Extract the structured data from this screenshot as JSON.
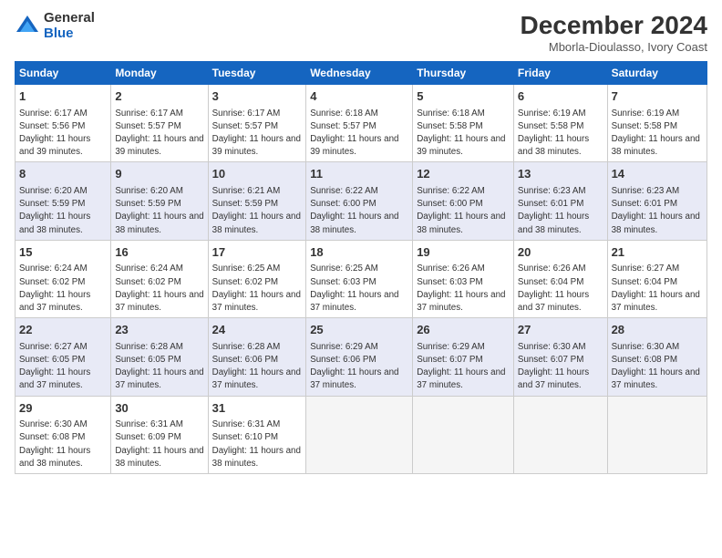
{
  "logo": {
    "general": "General",
    "blue": "Blue"
  },
  "title": "December 2024",
  "subtitle": "Mborla-Dioulasso, Ivory Coast",
  "header_days": [
    "Sunday",
    "Monday",
    "Tuesday",
    "Wednesday",
    "Thursday",
    "Friday",
    "Saturday"
  ],
  "weeks": [
    [
      {
        "day": "1",
        "sunrise": "Sunrise: 6:17 AM",
        "sunset": "Sunset: 5:56 PM",
        "daylight": "Daylight: 11 hours and 39 minutes."
      },
      {
        "day": "2",
        "sunrise": "Sunrise: 6:17 AM",
        "sunset": "Sunset: 5:57 PM",
        "daylight": "Daylight: 11 hours and 39 minutes."
      },
      {
        "day": "3",
        "sunrise": "Sunrise: 6:17 AM",
        "sunset": "Sunset: 5:57 PM",
        "daylight": "Daylight: 11 hours and 39 minutes."
      },
      {
        "day": "4",
        "sunrise": "Sunrise: 6:18 AM",
        "sunset": "Sunset: 5:57 PM",
        "daylight": "Daylight: 11 hours and 39 minutes."
      },
      {
        "day": "5",
        "sunrise": "Sunrise: 6:18 AM",
        "sunset": "Sunset: 5:58 PM",
        "daylight": "Daylight: 11 hours and 39 minutes."
      },
      {
        "day": "6",
        "sunrise": "Sunrise: 6:19 AM",
        "sunset": "Sunset: 5:58 PM",
        "daylight": "Daylight: 11 hours and 38 minutes."
      },
      {
        "day": "7",
        "sunrise": "Sunrise: 6:19 AM",
        "sunset": "Sunset: 5:58 PM",
        "daylight": "Daylight: 11 hours and 38 minutes."
      }
    ],
    [
      {
        "day": "8",
        "sunrise": "Sunrise: 6:20 AM",
        "sunset": "Sunset: 5:59 PM",
        "daylight": "Daylight: 11 hours and 38 minutes."
      },
      {
        "day": "9",
        "sunrise": "Sunrise: 6:20 AM",
        "sunset": "Sunset: 5:59 PM",
        "daylight": "Daylight: 11 hours and 38 minutes."
      },
      {
        "day": "10",
        "sunrise": "Sunrise: 6:21 AM",
        "sunset": "Sunset: 5:59 PM",
        "daylight": "Daylight: 11 hours and 38 minutes."
      },
      {
        "day": "11",
        "sunrise": "Sunrise: 6:22 AM",
        "sunset": "Sunset: 6:00 PM",
        "daylight": "Daylight: 11 hours and 38 minutes."
      },
      {
        "day": "12",
        "sunrise": "Sunrise: 6:22 AM",
        "sunset": "Sunset: 6:00 PM",
        "daylight": "Daylight: 11 hours and 38 minutes."
      },
      {
        "day": "13",
        "sunrise": "Sunrise: 6:23 AM",
        "sunset": "Sunset: 6:01 PM",
        "daylight": "Daylight: 11 hours and 38 minutes."
      },
      {
        "day": "14",
        "sunrise": "Sunrise: 6:23 AM",
        "sunset": "Sunset: 6:01 PM",
        "daylight": "Daylight: 11 hours and 38 minutes."
      }
    ],
    [
      {
        "day": "15",
        "sunrise": "Sunrise: 6:24 AM",
        "sunset": "Sunset: 6:02 PM",
        "daylight": "Daylight: 11 hours and 37 minutes."
      },
      {
        "day": "16",
        "sunrise": "Sunrise: 6:24 AM",
        "sunset": "Sunset: 6:02 PM",
        "daylight": "Daylight: 11 hours and 37 minutes."
      },
      {
        "day": "17",
        "sunrise": "Sunrise: 6:25 AM",
        "sunset": "Sunset: 6:02 PM",
        "daylight": "Daylight: 11 hours and 37 minutes."
      },
      {
        "day": "18",
        "sunrise": "Sunrise: 6:25 AM",
        "sunset": "Sunset: 6:03 PM",
        "daylight": "Daylight: 11 hours and 37 minutes."
      },
      {
        "day": "19",
        "sunrise": "Sunrise: 6:26 AM",
        "sunset": "Sunset: 6:03 PM",
        "daylight": "Daylight: 11 hours and 37 minutes."
      },
      {
        "day": "20",
        "sunrise": "Sunrise: 6:26 AM",
        "sunset": "Sunset: 6:04 PM",
        "daylight": "Daylight: 11 hours and 37 minutes."
      },
      {
        "day": "21",
        "sunrise": "Sunrise: 6:27 AM",
        "sunset": "Sunset: 6:04 PM",
        "daylight": "Daylight: 11 hours and 37 minutes."
      }
    ],
    [
      {
        "day": "22",
        "sunrise": "Sunrise: 6:27 AM",
        "sunset": "Sunset: 6:05 PM",
        "daylight": "Daylight: 11 hours and 37 minutes."
      },
      {
        "day": "23",
        "sunrise": "Sunrise: 6:28 AM",
        "sunset": "Sunset: 6:05 PM",
        "daylight": "Daylight: 11 hours and 37 minutes."
      },
      {
        "day": "24",
        "sunrise": "Sunrise: 6:28 AM",
        "sunset": "Sunset: 6:06 PM",
        "daylight": "Daylight: 11 hours and 37 minutes."
      },
      {
        "day": "25",
        "sunrise": "Sunrise: 6:29 AM",
        "sunset": "Sunset: 6:06 PM",
        "daylight": "Daylight: 11 hours and 37 minutes."
      },
      {
        "day": "26",
        "sunrise": "Sunrise: 6:29 AM",
        "sunset": "Sunset: 6:07 PM",
        "daylight": "Daylight: 11 hours and 37 minutes."
      },
      {
        "day": "27",
        "sunrise": "Sunrise: 6:30 AM",
        "sunset": "Sunset: 6:07 PM",
        "daylight": "Daylight: 11 hours and 37 minutes."
      },
      {
        "day": "28",
        "sunrise": "Sunrise: 6:30 AM",
        "sunset": "Sunset: 6:08 PM",
        "daylight": "Daylight: 11 hours and 37 minutes."
      }
    ],
    [
      {
        "day": "29",
        "sunrise": "Sunrise: 6:30 AM",
        "sunset": "Sunset: 6:08 PM",
        "daylight": "Daylight: 11 hours and 38 minutes."
      },
      {
        "day": "30",
        "sunrise": "Sunrise: 6:31 AM",
        "sunset": "Sunset: 6:09 PM",
        "daylight": "Daylight: 11 hours and 38 minutes."
      },
      {
        "day": "31",
        "sunrise": "Sunrise: 6:31 AM",
        "sunset": "Sunset: 6:10 PM",
        "daylight": "Daylight: 11 hours and 38 minutes."
      },
      null,
      null,
      null,
      null
    ]
  ]
}
